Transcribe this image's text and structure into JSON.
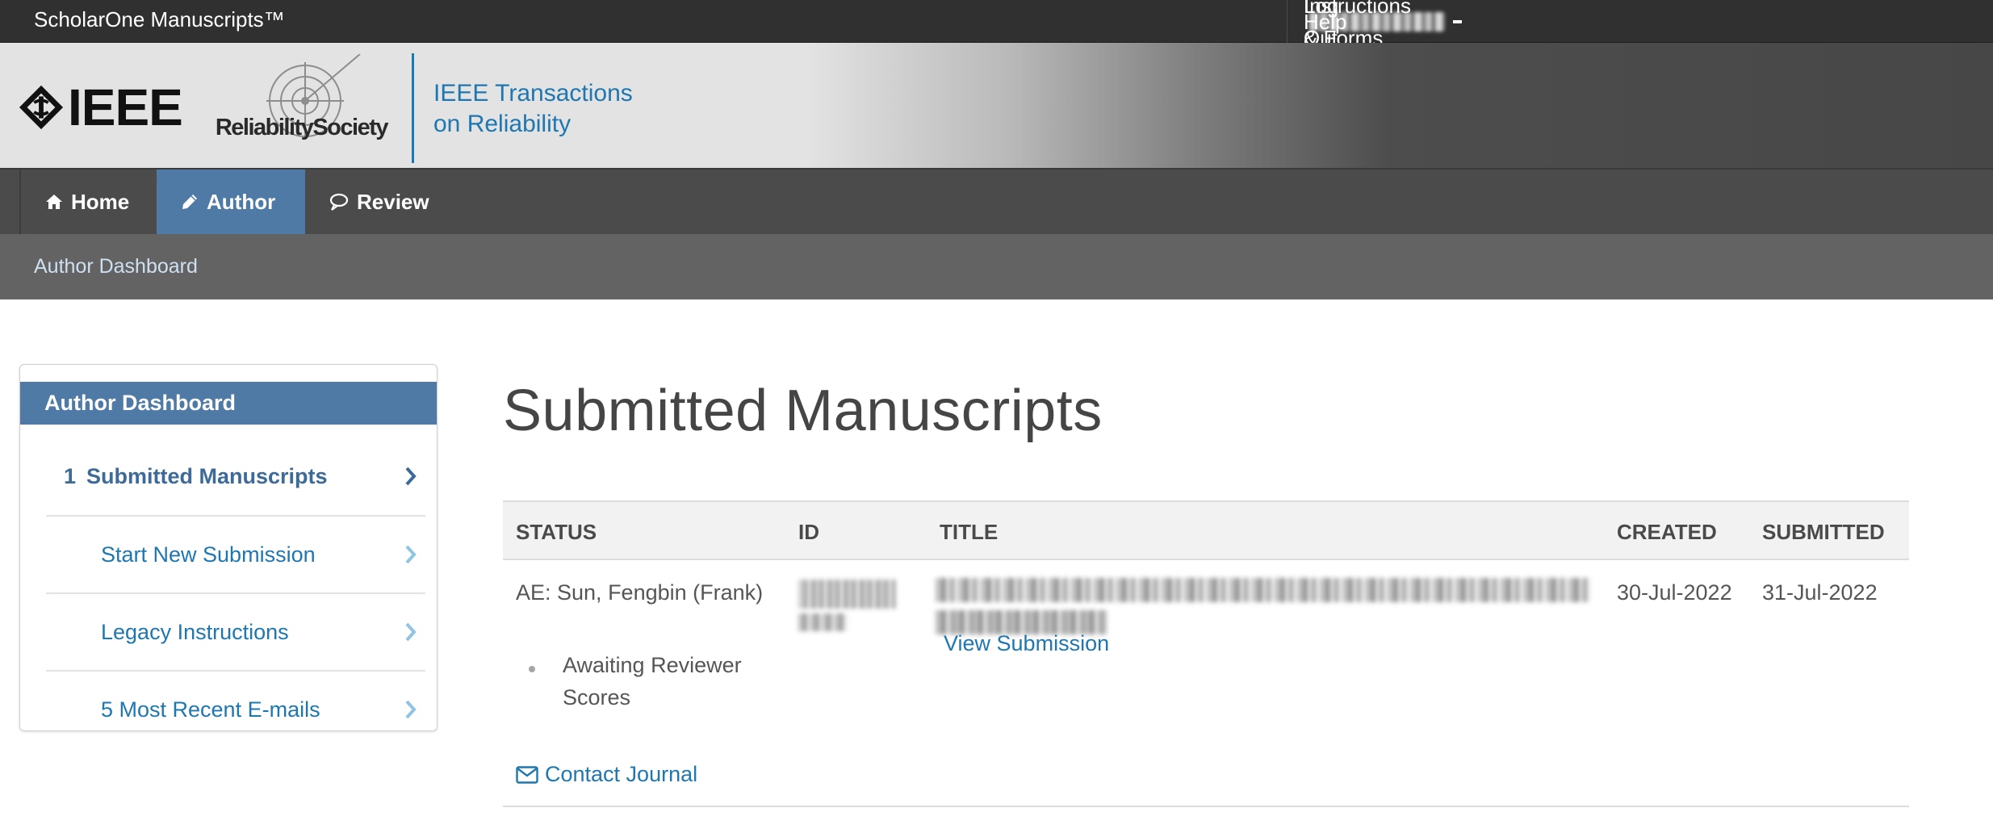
{
  "topbar": {
    "brand": "ScholarOne Manuscripts™",
    "instructions_label": "Instructions & Forms",
    "help_label": "Help",
    "logout_label": "Log Out"
  },
  "banner": {
    "ieee_text": "IEEE",
    "society_text": "ReliabilitySociety",
    "journal_line1": "IEEE Transactions",
    "journal_line2": "on Reliability"
  },
  "mainnav": {
    "home_label": "Home",
    "author_label": "Author",
    "review_label": "Review",
    "active": "Author"
  },
  "breadcrumb": "Author Dashboard",
  "sidebar": {
    "title": "Author Dashboard",
    "items": [
      {
        "count": "1",
        "label": "Submitted Manuscripts",
        "active": true
      },
      {
        "count": "",
        "label": "Start New Submission",
        "active": false
      },
      {
        "count": "",
        "label": "Legacy Instructions",
        "active": false
      },
      {
        "count": "",
        "label": "5 Most Recent E-mails",
        "active": false
      }
    ]
  },
  "main": {
    "title": "Submitted Manuscripts",
    "columns": [
      "STATUS",
      "ID",
      "TITLE",
      "CREATED",
      "SUBMITTED"
    ],
    "rows": [
      {
        "editor": "AE: Sun, Fengbin (Frank)",
        "status": "Awaiting Reviewer Scores",
        "view_label": "View Submission",
        "created": "30-Jul-2022",
        "submitted": "31-Jul-2022"
      }
    ],
    "contact_label": "Contact Journal"
  },
  "icons": {
    "home": "home-icon",
    "author": "pencil-icon",
    "review": "speech-bubble-icon",
    "chevron": "chevron-right-icon",
    "contact": "envelope-icon",
    "caret": "caret-down-icon"
  },
  "colors": {
    "topbar": "#303030",
    "nav": "#4b4b4b",
    "subnav": "#636363",
    "accent": "#4e7aa5",
    "link": "#1e77b0"
  }
}
